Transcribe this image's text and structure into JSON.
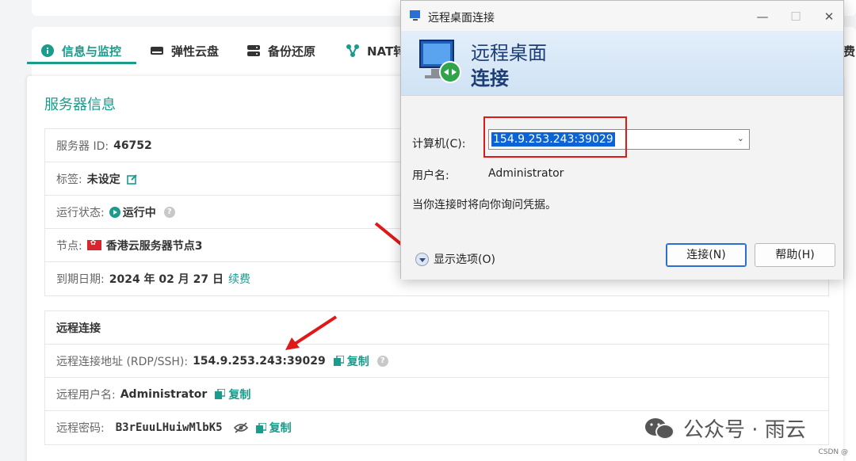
{
  "tabs": [
    {
      "label": "信息与监控",
      "icon": "info-icon",
      "active": true
    },
    {
      "label": "弹性云盘",
      "icon": "disk-icon"
    },
    {
      "label": "备份还原",
      "icon": "backup-icon"
    },
    {
      "label": "NAT转",
      "icon": "nat-icon"
    },
    {
      "label": "费",
      "icon": ""
    }
  ],
  "accent": "#1a9b8b",
  "server_info": {
    "title": "服务器信息",
    "id_label": "服务器 ID:",
    "id_value": "46752",
    "tag_label": "标签:",
    "tag_value": "未设定",
    "status_label": "运行状态:",
    "status_value": "运行中",
    "node_label": "节点:",
    "node_value": "香港云服务器节点3",
    "expire_label": "到期日期:",
    "expire_value": "2024 年 02 月 27 日",
    "renew_link": "续费"
  },
  "remote": {
    "title": "远程连接",
    "addr_label": "远程连接地址 (RDP/SSH):",
    "addr_value": "154.9.253.243:39029",
    "user_label": "远程用户名:",
    "user_value": "Administrator",
    "pass_label": "远程密码:",
    "pass_value": "B3rEuuLHuiwMlbK5",
    "copy_label": "复制"
  },
  "dialog": {
    "title": "远程桌面连接",
    "banner_line1": "远程桌面",
    "banner_line2": "连接",
    "computer_label": "计算机(C):",
    "computer_value": "154.9.253.243:39029",
    "username_label": "用户名:",
    "username_value": "Administrator",
    "note": "当你连接时将向你询问凭据。",
    "show_options": "显示选项(O)",
    "connect_btn": "连接(N)",
    "help_btn": "帮助(H)",
    "minimize": "—",
    "maximize": "☐",
    "close": "✕"
  },
  "watermark": "公众号 · 雨云",
  "footer": "CSDN @"
}
